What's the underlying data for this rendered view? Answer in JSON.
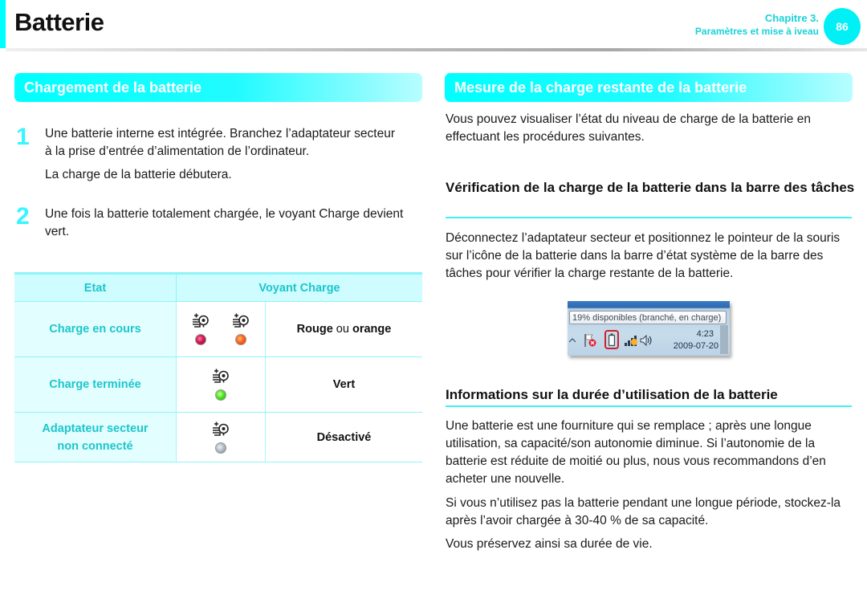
{
  "header": {
    "title": "Batterie",
    "chapter_label": "Chapitre 3.",
    "chapter_name": "Paramètres et mise à iveau",
    "page_number": "86",
    "accent_color": "#00ffff"
  },
  "left": {
    "section_title": "Chargement de la batterie",
    "steps": [
      {
        "number": "1",
        "text": "Une batterie interne est intégrée. Branchez l’adaptateur secteur à la prise d’entrée d’alimentation de l’ordinateur.",
        "note": "La charge de la batterie débutera."
      },
      {
        "number": "2",
        "text": "Une fois la batterie totalement chargée, le voyant Charge devient vert."
      }
    ],
    "table": {
      "headers": [
        "Etat",
        "Voyant Charge"
      ],
      "rows": [
        {
          "state": "Charge en cours",
          "leds": [
            "red",
            "orange"
          ],
          "color_parts": [
            "Rouge",
            " ou ",
            "orange"
          ]
        },
        {
          "state": "Charge terminée",
          "leds": [
            "green"
          ],
          "color": "Vert"
        },
        {
          "state_line1": "Adaptateur secteur",
          "state_line2": "non connecté",
          "leds": [
            "gray"
          ],
          "color": "Désactivé"
        }
      ],
      "icon": "charge-indicator-icon"
    }
  },
  "right": {
    "section_title": "Mesure de la charge restante de la batterie",
    "intro": "Vous pouvez visualiser l’état du niveau de charge de la batterie en effectuant les procédures suivantes.",
    "sub1": {
      "title": "Vérification de la charge de la batterie dans la barre des tâches",
      "text": "Déconnectez l’adaptateur secteur et positionnez le pointeur de la souris sur l’icône de la batterie dans la barre d’état système de la barre des tâches pour vérifier la charge restante de la batterie."
    },
    "taskbar": {
      "tooltip": "19% disponibles (branché, en charge)",
      "time": "4:23",
      "date": "2009-07-20"
    },
    "sub2": {
      "title": "Informations sur la durée d’utilisation de la batterie",
      "p1": "Une batterie est une fourniture qui se remplace ; après une longue utilisation, sa capacité/son autonomie diminue. Si l’autonomie de la batterie est réduite de moitié ou plus, nous vous recommandons d’en acheter une nouvelle.",
      "p2": "Si vous n’utilisez pas la batterie pendant une longue période, stockez-la après l’avoir chargée à 30-40 % de sa capacité.",
      "p3": "Vous préservez ainsi sa durée de vie."
    }
  }
}
